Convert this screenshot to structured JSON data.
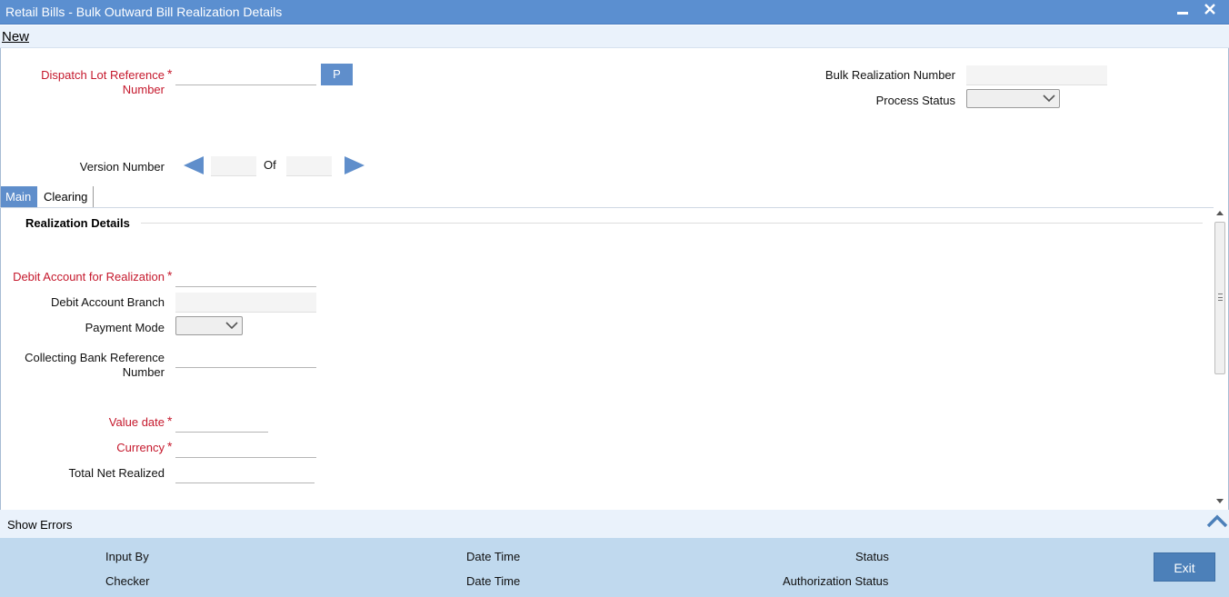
{
  "window": {
    "title": "Retail Bills - Bulk Outward Bill Realization Details",
    "minimize_glyph": "▬",
    "close_glyph": "✕"
  },
  "menu": {
    "new_label": "New"
  },
  "header": {
    "dispatch_lot_label": "Dispatch Lot Reference Number",
    "dispatch_lot_value": "",
    "p_button": "P",
    "bulk_realization_label": "Bulk Realization Number",
    "bulk_realization_value": "",
    "process_status_label": "Process Status",
    "process_status_value": "",
    "version_number_label": "Version Number",
    "version_value": "",
    "of_label": "Of",
    "of_value": "",
    "required_marker": "*"
  },
  "tabs": [
    {
      "label": "Main",
      "active": true
    },
    {
      "label": "Clearing",
      "active": false
    }
  ],
  "realization": {
    "section_title": "Realization Details",
    "debit_account_label": "Debit Account for Realization",
    "debit_account_value": "",
    "debit_branch_label": "Debit Account Branch",
    "debit_branch_value": "",
    "payment_mode_label": "Payment Mode",
    "payment_mode_value": "",
    "collecting_bank_label": "Collecting Bank Reference Number",
    "collecting_bank_value": "",
    "value_date_label": "Value date",
    "value_date_value": "",
    "currency_label": "Currency",
    "currency_value": "",
    "total_net_label": "Total Net Realized",
    "total_net_value": ""
  },
  "errors": {
    "show_errors_label": "Show Errors"
  },
  "footer": {
    "input_by": "Input By",
    "checker": "Checker",
    "date_time_1": "Date Time",
    "date_time_2": "Date Time",
    "status": "Status",
    "authorization_status": "Authorization Status",
    "exit_label": "Exit"
  },
  "colors": {
    "title_bar": "#5b8fd0",
    "required_text": "#c5182c",
    "accent_button": "#5f8ecb",
    "footer_bg": "#c0d9ee",
    "exit_button": "#4c80b9"
  }
}
